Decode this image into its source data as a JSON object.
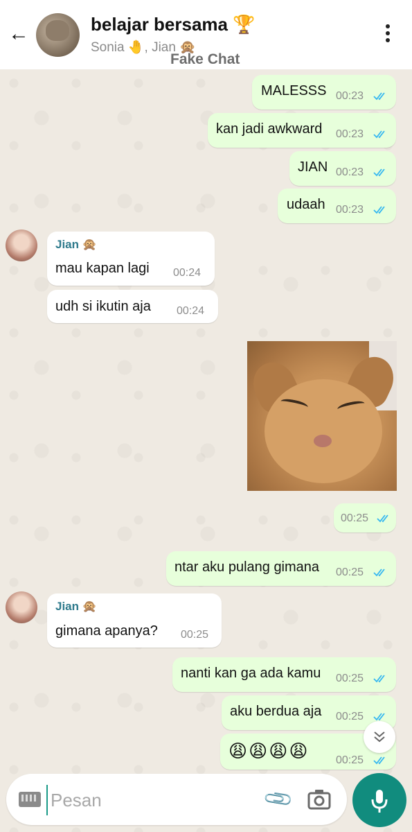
{
  "header": {
    "back_icon": "arrow-left-icon",
    "title": "belajar bersama 🏆",
    "members": "Sonia 🤚, Jian 🙊",
    "watermark": "Fake Chat",
    "menu_icon": "more-vert-icon"
  },
  "messages": [
    {
      "text": "MALESSS",
      "time": "00:23",
      "direction": "outgoing",
      "status": "read"
    },
    {
      "text": "kan jadi awkward",
      "time": "00:23",
      "direction": "outgoing",
      "status": "read"
    },
    {
      "text": "JIAN",
      "time": "00:23",
      "direction": "outgoing",
      "status": "read"
    },
    {
      "text": "udaah",
      "time": "00:23",
      "direction": "outgoing",
      "status": "read"
    },
    {
      "sender": "Jian 🙊",
      "text": "mau kapan lagi",
      "time": "00:24",
      "direction": "incoming"
    },
    {
      "text": "udh si ikutin aja",
      "time": "00:24",
      "direction": "incoming"
    },
    {
      "type": "sticker",
      "description_icon": "smiling-cat-sticker"
    },
    {
      "text": "",
      "time": "00:25",
      "direction": "outgoing",
      "status": "read"
    },
    {
      "text": "ntar aku pulang gimana",
      "time": "00:25",
      "direction": "outgoing",
      "status": "read"
    },
    {
      "sender": "Jian 🙊",
      "text": "gimana apanya?",
      "time": "00:25",
      "direction": "incoming"
    },
    {
      "text": "nanti kan ga ada kamu",
      "time": "00:25",
      "direction": "outgoing",
      "status": "read"
    },
    {
      "text": "aku berdua aja",
      "time": "00:25",
      "direction": "outgoing",
      "status": "read"
    },
    {
      "text": "😩😩😩😩",
      "time": "00:25",
      "direction": "outgoing",
      "status": "read"
    }
  ],
  "input": {
    "placeholder": "Pesan",
    "value": "",
    "keyboard_icon": "keyboard-icon",
    "attach_icon": "paperclip-icon",
    "camera_icon": "camera-icon",
    "mic_icon": "microphone-icon"
  },
  "colors": {
    "outgoing_bubble": "#e7ffdb",
    "incoming_bubble": "#ffffff",
    "read_ticks": "#34b7f1",
    "sender_name": "#2e7a8c",
    "mic_button": "#118c7e"
  }
}
